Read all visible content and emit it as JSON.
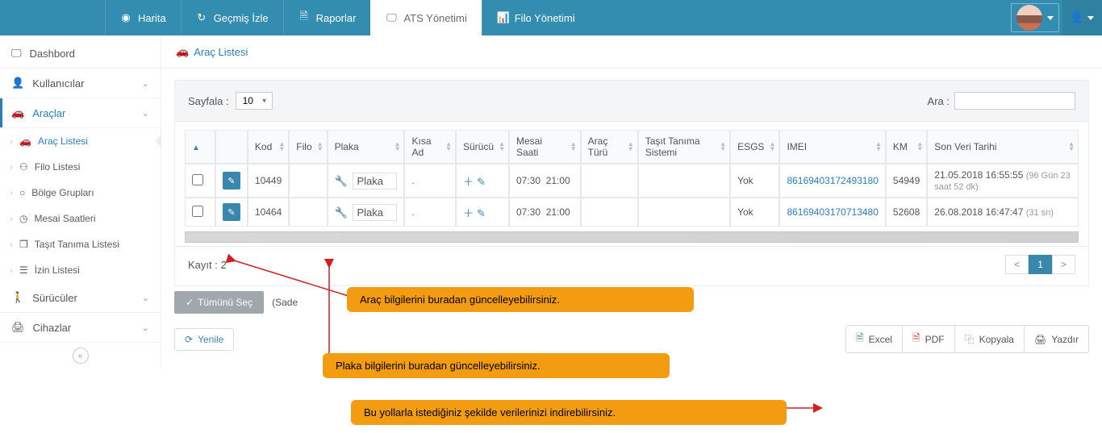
{
  "topnav": {
    "items": [
      {
        "icon": "globe",
        "label": "Harita"
      },
      {
        "icon": "refresh",
        "label": "Geçmiş İzle"
      },
      {
        "icon": "file",
        "label": "Raporlar"
      },
      {
        "icon": "monitor",
        "label": "ATS Yönetimi",
        "active": true
      },
      {
        "icon": "dashboard",
        "label": "Filo Yönetimi"
      }
    ]
  },
  "sidebar": {
    "dashboard": {
      "label": "Dashbord"
    },
    "users": {
      "label": "Kullanıcılar"
    },
    "vehicles": {
      "label": "Araçlar",
      "sub": [
        {
          "label": "Araç Listesi",
          "icon": "car",
          "active": true
        },
        {
          "label": "Filo Listesi",
          "icon": "sitemap"
        },
        {
          "label": "Bölge Grupları",
          "icon": "circle"
        },
        {
          "label": "Mesai Saatleri",
          "icon": "clock"
        },
        {
          "label": "Taşıt Tanıma Listesi",
          "icon": "cube"
        },
        {
          "label": "İzin Listesi",
          "icon": "list"
        }
      ]
    },
    "drivers": {
      "label": "Sürücüler"
    },
    "devices": {
      "label": "Cihazlar"
    }
  },
  "breadcrumb": {
    "label": "Araç Listesi"
  },
  "toolbar": {
    "paginate_label": "Sayfala :",
    "page_size": "10",
    "search_label": "Ara :",
    "search_value": ""
  },
  "table": {
    "headers": {
      "check": "▲",
      "kod": "Kod",
      "filo": "Filo",
      "plaka": "Plaka",
      "kisa_ad": "Kısa Ad",
      "surucu": "Sürücü",
      "mesai": "Mesai Saati",
      "arac_turu": "Araç Türü",
      "tasit_tanima": "Taşıt Tanıma Sistemi",
      "esgs": "ESGS",
      "imei": "IMEI",
      "km": "KM",
      "son_veri": "Son Veri Tarihi"
    },
    "rows": [
      {
        "kod": "10449",
        "filo": "",
        "plaka": "Plaka",
        "kisa_ad": ".",
        "surucu": "",
        "mesai_start": "07:30",
        "mesai_end": "21:00",
        "arac_turu": "",
        "tasit_tanima": "",
        "esgs": "Yok",
        "imei": "86169403172493180",
        "km": "54949",
        "son_veri": "21.05.2018 16:55:55",
        "son_veri_ago": "(96 Gün 23 saat 52 dk)"
      },
      {
        "kod": "10464",
        "filo": "",
        "plaka": "Plaka",
        "kisa_ad": ".",
        "surucu": "",
        "mesai_start": "07:30",
        "mesai_end": "21:00",
        "arac_turu": "",
        "tasit_tanima": "",
        "esgs": "Yok",
        "imei": "86169403170713480",
        "km": "52608",
        "son_veri": "26.08.2018 16:47:47",
        "son_veri_ago": "(31 sn)"
      }
    ]
  },
  "footer": {
    "record_label": "Kayıt : 2",
    "page_current": "1",
    "select_all": "Tümünü Seç",
    "note_partial": "(Sade",
    "refresh": "Yenile",
    "export": {
      "excel": "Excel",
      "pdf": "PDF",
      "copy": "Kopyala",
      "print": "Yazdır"
    }
  },
  "callouts": {
    "c1": "Araç bilgilerini buradan güncelleyebilirsiniz.",
    "c2": "Plaka bilgilerini buradan güncelleyebilirsiniz.",
    "c3": "Bu yollarla istediğiniz şekilde verilerinizi indirebilirsiniz."
  }
}
